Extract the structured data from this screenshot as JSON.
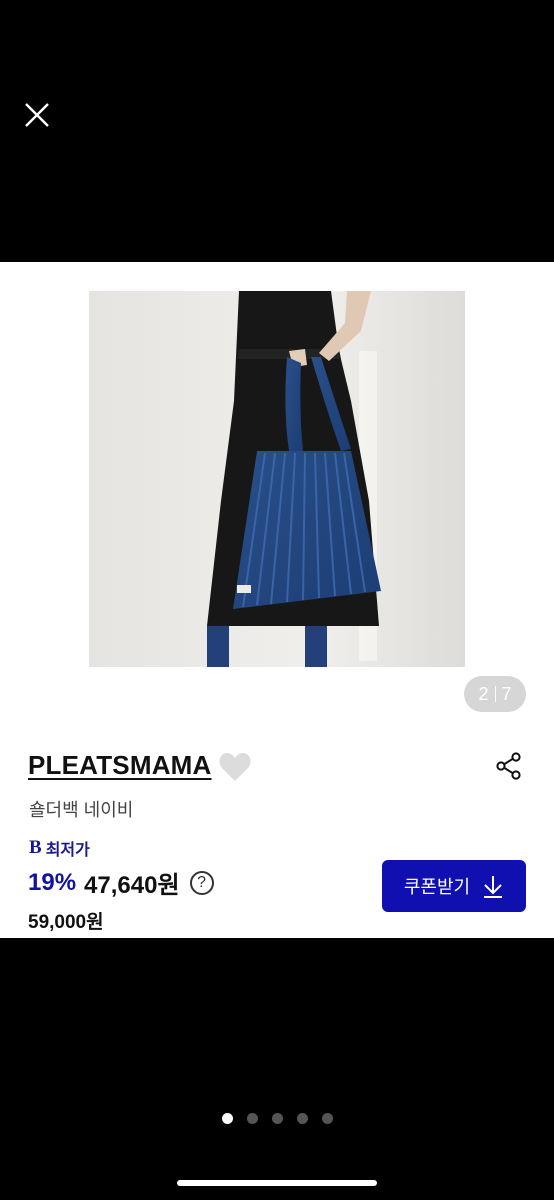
{
  "pager": {
    "current": "2",
    "total": "7"
  },
  "product": {
    "brand": "PLEATSMAMA",
    "name": "숄더백 네이비",
    "badge_logo": "B",
    "badge_label": "최저가",
    "discount": "19%",
    "price": "47,640원",
    "original_price": "59,000원",
    "help_symbol": "?"
  },
  "coupon": {
    "label": "쿠폰받기",
    "icon": "download-arrow-icon"
  },
  "colors": {
    "accent": "#1010b0",
    "discount": "#1212a0"
  },
  "carousel": {
    "count": 5,
    "active_index": 0
  }
}
